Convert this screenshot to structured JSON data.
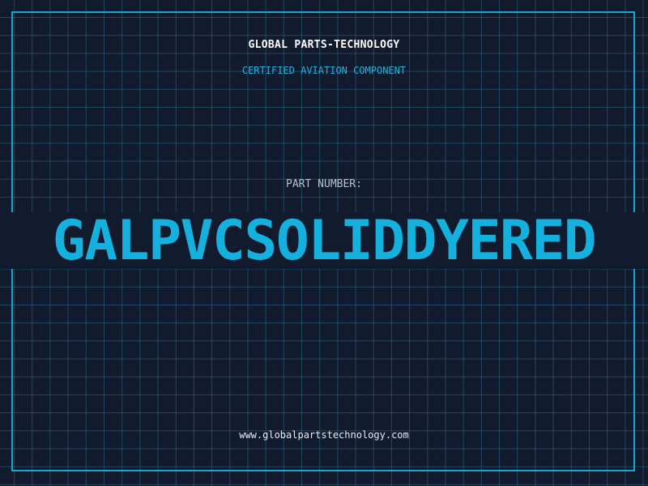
{
  "header": {
    "company": "GLOBAL PARTS-TECHNOLOGY",
    "subtitle": "CERTIFIED AVIATION COMPONENT"
  },
  "part": {
    "label": "PART NUMBER:",
    "number": "GALPVCSOLIDDYERED"
  },
  "footer": {
    "url": "www.globalpartstechnology.com"
  },
  "colors": {
    "background": "#121a2e",
    "accent": "#14b1de",
    "grid": "#286e8c",
    "text": "#ffffff"
  }
}
